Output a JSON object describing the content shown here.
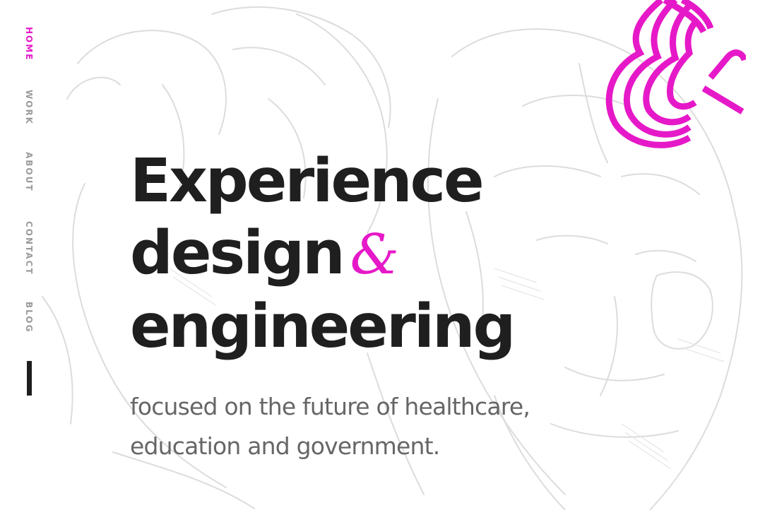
{
  "nav": {
    "items": [
      {
        "label": "HOME",
        "active": true
      },
      {
        "label": "WORK",
        "active": false
      },
      {
        "label": "ABOUT",
        "active": false
      },
      {
        "label": "CONTACT",
        "active": false
      },
      {
        "label": "BLOG",
        "active": false
      }
    ]
  },
  "hero": {
    "title_line1": "Experience",
    "title_line2": "design",
    "title_ampersand": "&",
    "title_line3": "engineering",
    "subtitle_line1": "focused on the future of healthcare,",
    "subtitle_line2": "education and government."
  },
  "logo": {
    "icon": "ampersand-f-logo-icon"
  },
  "colors": {
    "accent": "#e619c8",
    "heading": "#1f1f1f",
    "subtitle": "#666666",
    "nav_inactive": "#9a9a9a",
    "background": "#ffffff"
  }
}
